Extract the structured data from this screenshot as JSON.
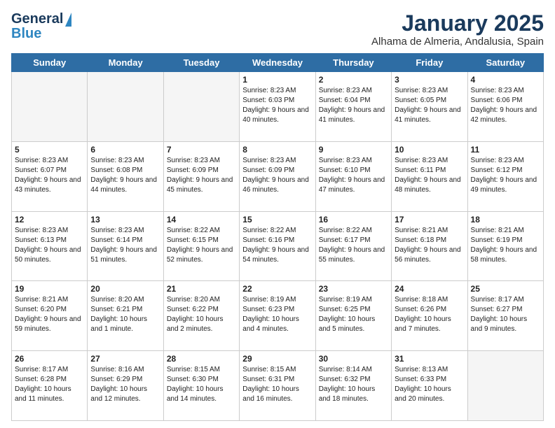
{
  "header": {
    "logo_line1": "General",
    "logo_line2": "Blue",
    "title": "January 2025",
    "subtitle": "Alhama de Almeria, Andalusia, Spain"
  },
  "days_of_week": [
    "Sunday",
    "Monday",
    "Tuesday",
    "Wednesday",
    "Thursday",
    "Friday",
    "Saturday"
  ],
  "weeks": [
    [
      {
        "day": "",
        "info": ""
      },
      {
        "day": "",
        "info": ""
      },
      {
        "day": "",
        "info": ""
      },
      {
        "day": "1",
        "info": "Sunrise: 8:23 AM\nSunset: 6:03 PM\nDaylight: 9 hours\nand 40 minutes."
      },
      {
        "day": "2",
        "info": "Sunrise: 8:23 AM\nSunset: 6:04 PM\nDaylight: 9 hours\nand 41 minutes."
      },
      {
        "day": "3",
        "info": "Sunrise: 8:23 AM\nSunset: 6:05 PM\nDaylight: 9 hours\nand 41 minutes."
      },
      {
        "day": "4",
        "info": "Sunrise: 8:23 AM\nSunset: 6:06 PM\nDaylight: 9 hours\nand 42 minutes."
      }
    ],
    [
      {
        "day": "5",
        "info": "Sunrise: 8:23 AM\nSunset: 6:07 PM\nDaylight: 9 hours\nand 43 minutes."
      },
      {
        "day": "6",
        "info": "Sunrise: 8:23 AM\nSunset: 6:08 PM\nDaylight: 9 hours\nand 44 minutes."
      },
      {
        "day": "7",
        "info": "Sunrise: 8:23 AM\nSunset: 6:09 PM\nDaylight: 9 hours\nand 45 minutes."
      },
      {
        "day": "8",
        "info": "Sunrise: 8:23 AM\nSunset: 6:09 PM\nDaylight: 9 hours\nand 46 minutes."
      },
      {
        "day": "9",
        "info": "Sunrise: 8:23 AM\nSunset: 6:10 PM\nDaylight: 9 hours\nand 47 minutes."
      },
      {
        "day": "10",
        "info": "Sunrise: 8:23 AM\nSunset: 6:11 PM\nDaylight: 9 hours\nand 48 minutes."
      },
      {
        "day": "11",
        "info": "Sunrise: 8:23 AM\nSunset: 6:12 PM\nDaylight: 9 hours\nand 49 minutes."
      }
    ],
    [
      {
        "day": "12",
        "info": "Sunrise: 8:23 AM\nSunset: 6:13 PM\nDaylight: 9 hours\nand 50 minutes."
      },
      {
        "day": "13",
        "info": "Sunrise: 8:23 AM\nSunset: 6:14 PM\nDaylight: 9 hours\nand 51 minutes."
      },
      {
        "day": "14",
        "info": "Sunrise: 8:22 AM\nSunset: 6:15 PM\nDaylight: 9 hours\nand 52 minutes."
      },
      {
        "day": "15",
        "info": "Sunrise: 8:22 AM\nSunset: 6:16 PM\nDaylight: 9 hours\nand 54 minutes."
      },
      {
        "day": "16",
        "info": "Sunrise: 8:22 AM\nSunset: 6:17 PM\nDaylight: 9 hours\nand 55 minutes."
      },
      {
        "day": "17",
        "info": "Sunrise: 8:21 AM\nSunset: 6:18 PM\nDaylight: 9 hours\nand 56 minutes."
      },
      {
        "day": "18",
        "info": "Sunrise: 8:21 AM\nSunset: 6:19 PM\nDaylight: 9 hours\nand 58 minutes."
      }
    ],
    [
      {
        "day": "19",
        "info": "Sunrise: 8:21 AM\nSunset: 6:20 PM\nDaylight: 9 hours\nand 59 minutes."
      },
      {
        "day": "20",
        "info": "Sunrise: 8:20 AM\nSunset: 6:21 PM\nDaylight: 10 hours\nand 1 minute."
      },
      {
        "day": "21",
        "info": "Sunrise: 8:20 AM\nSunset: 6:22 PM\nDaylight: 10 hours\nand 2 minutes."
      },
      {
        "day": "22",
        "info": "Sunrise: 8:19 AM\nSunset: 6:23 PM\nDaylight: 10 hours\nand 4 minutes."
      },
      {
        "day": "23",
        "info": "Sunrise: 8:19 AM\nSunset: 6:25 PM\nDaylight: 10 hours\nand 5 minutes."
      },
      {
        "day": "24",
        "info": "Sunrise: 8:18 AM\nSunset: 6:26 PM\nDaylight: 10 hours\nand 7 minutes."
      },
      {
        "day": "25",
        "info": "Sunrise: 8:17 AM\nSunset: 6:27 PM\nDaylight: 10 hours\nand 9 minutes."
      }
    ],
    [
      {
        "day": "26",
        "info": "Sunrise: 8:17 AM\nSunset: 6:28 PM\nDaylight: 10 hours\nand 11 minutes."
      },
      {
        "day": "27",
        "info": "Sunrise: 8:16 AM\nSunset: 6:29 PM\nDaylight: 10 hours\nand 12 minutes."
      },
      {
        "day": "28",
        "info": "Sunrise: 8:15 AM\nSunset: 6:30 PM\nDaylight: 10 hours\nand 14 minutes."
      },
      {
        "day": "29",
        "info": "Sunrise: 8:15 AM\nSunset: 6:31 PM\nDaylight: 10 hours\nand 16 minutes."
      },
      {
        "day": "30",
        "info": "Sunrise: 8:14 AM\nSunset: 6:32 PM\nDaylight: 10 hours\nand 18 minutes."
      },
      {
        "day": "31",
        "info": "Sunrise: 8:13 AM\nSunset: 6:33 PM\nDaylight: 10 hours\nand 20 minutes."
      },
      {
        "day": "",
        "info": ""
      }
    ]
  ]
}
